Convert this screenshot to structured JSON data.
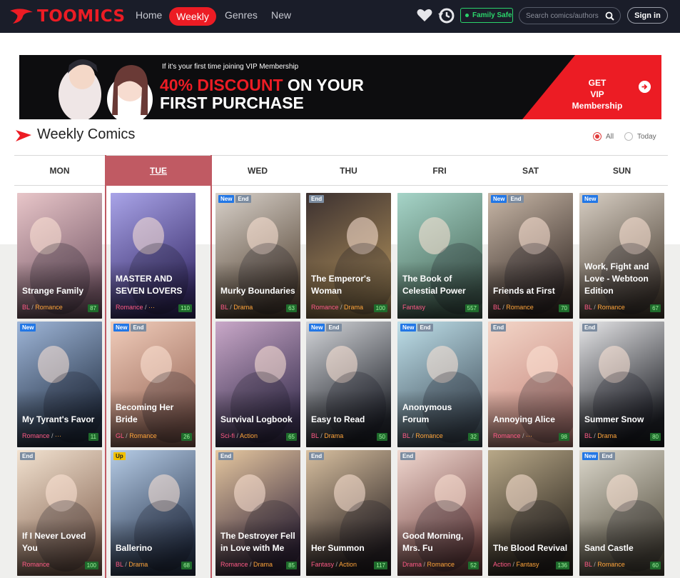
{
  "nav": {
    "logo": "TOOMICS",
    "links": [
      "Home",
      "Weekly",
      "Genres",
      "New"
    ],
    "family_safe": "Family Safe",
    "search_placeholder": "Search comics/authors",
    "signin": "Sign in"
  },
  "banner": {
    "small": "If it's your first time joining VIP Membership",
    "discount": "40% DISCOUNT",
    "line1_rest": " ON YOUR",
    "line2": "FIRST PURCHASE",
    "cta_line1": "GET",
    "cta_line2": "VIP Membership"
  },
  "section": {
    "title": "Weekly Comics",
    "radio_all": "All",
    "radio_today": "Today",
    "selected": "All"
  },
  "days": [
    "MON",
    "TUE",
    "WED",
    "THU",
    "FRI",
    "SAT",
    "SUN"
  ],
  "active_day": "TUE",
  "cards": [
    {
      "title": "Strange Family",
      "g1": "BL",
      "g2": "Romance",
      "num": "87",
      "badges": [],
      "c1": "#e8c6c9",
      "c2": "#7a5b6a"
    },
    {
      "title": "MASTER AND SEVEN LOVERS",
      "g1": "Romance",
      "g2": "···",
      "num": "110",
      "badges": [],
      "c1": "#a9a4e8",
      "c2": "#3b2f6e"
    },
    {
      "title": "Murky Boundaries",
      "g1": "BL",
      "g2": "Drama",
      "num": "63",
      "badges": [
        "New",
        "End"
      ],
      "c1": "#d9d2cb",
      "c2": "#5a4a3a"
    },
    {
      "title": "The Emperor's Woman",
      "g1": "Romance",
      "g2": "Drama",
      "num": "100",
      "badges": [
        "End"
      ],
      "c1": "#3b3030",
      "c2": "#a88a58"
    },
    {
      "title": "The Book of Celestial Power",
      "g1": "Fantasy",
      "g2": "",
      "num": "557",
      "badges": [],
      "c1": "#a6d4c8",
      "c2": "#4a6a5a"
    },
    {
      "title": "Friends at First",
      "g1": "BL",
      "g2": "Romance",
      "num": "70",
      "badges": [
        "New",
        "End"
      ],
      "c1": "#c9b8a8",
      "c2": "#3a2f2a"
    },
    {
      "title": "Work, Fight and Love - Webtoon Edition",
      "g1": "BL",
      "g2": "Romance",
      "num": "67",
      "badges": [
        "New"
      ],
      "c1": "#d8cfc4",
      "c2": "#4f4438"
    },
    {
      "title": "My Tyrant's Favor",
      "g1": "Romance",
      "g2": "···",
      "num": "11",
      "badges": [
        "New"
      ],
      "c1": "#9fb6d8",
      "c2": "#263448"
    },
    {
      "title": "Becoming Her Bride",
      "g1": "GL",
      "g2": "Romance",
      "num": "26",
      "badges": [
        "New",
        "End"
      ],
      "c1": "#f1cdbb",
      "c2": "#9a6a5a"
    },
    {
      "title": "Survival Logbook",
      "g1": "Sci-fi",
      "g2": "Action",
      "num": "65",
      "badges": [],
      "c1": "#c9a8c8",
      "c2": "#3a3050"
    },
    {
      "title": "Easy to Read",
      "g1": "BL",
      "g2": "Drama",
      "num": "50",
      "badges": [
        "New",
        "End"
      ],
      "c1": "#d4d6da",
      "c2": "#22252c"
    },
    {
      "title": "Anonymous Forum",
      "g1": "BL",
      "g2": "Romance",
      "num": "32",
      "badges": [
        "New",
        "End"
      ],
      "c1": "#bfe0ea",
      "c2": "#4a5a66"
    },
    {
      "title": "Annoying Alice",
      "g1": "Romance",
      "g2": "···",
      "num": "98",
      "badges": [
        "End"
      ],
      "c1": "#f3d6c8",
      "c2": "#c88a80"
    },
    {
      "title": "Summer Snow",
      "g1": "BL",
      "g2": "Drama",
      "num": "80",
      "badges": [
        "End"
      ],
      "c1": "#e6e6e8",
      "c2": "#1c1e24"
    },
    {
      "title": "If I Never Loved You",
      "g1": "Romance",
      "g2": "",
      "num": "100",
      "badges": [
        "End"
      ],
      "c1": "#f2e2d0",
      "c2": "#8a6a58"
    },
    {
      "title": "Ballerino",
      "g1": "BL",
      "g2": "Drama",
      "num": "68",
      "badges": [
        "Up"
      ],
      "c1": "#b6cce6",
      "c2": "#2c3a52"
    },
    {
      "title": "The Destroyer Fell in Love with Me",
      "g1": "Romance",
      "g2": "Drama",
      "num": "85",
      "badges": [
        "End"
      ],
      "c1": "#e6c8a0",
      "c2": "#3a2a3e"
    },
    {
      "title": "Her Summon",
      "g1": "Fantasy",
      "g2": "Action",
      "num": "117",
      "badges": [
        "End"
      ],
      "c1": "#d8c0a0",
      "c2": "#2c2424"
    },
    {
      "title": "Good Morning, Mrs. Fu",
      "g1": "Drama",
      "g2": "Romance",
      "num": "52",
      "badges": [
        "End"
      ],
      "c1": "#f0d8d0",
      "c2": "#7a4a48"
    },
    {
      "title": "The Blood Revival",
      "g1": "Action",
      "g2": "Fantasy",
      "num": "136",
      "badges": [],
      "c1": "#b8a888",
      "c2": "#2e2820"
    },
    {
      "title": "Sand Castle",
      "g1": "BL",
      "g2": "Romance",
      "num": "60",
      "badges": [
        "New",
        "End"
      ],
      "c1": "#dcd8cc",
      "c2": "#5a5444"
    }
  ]
}
